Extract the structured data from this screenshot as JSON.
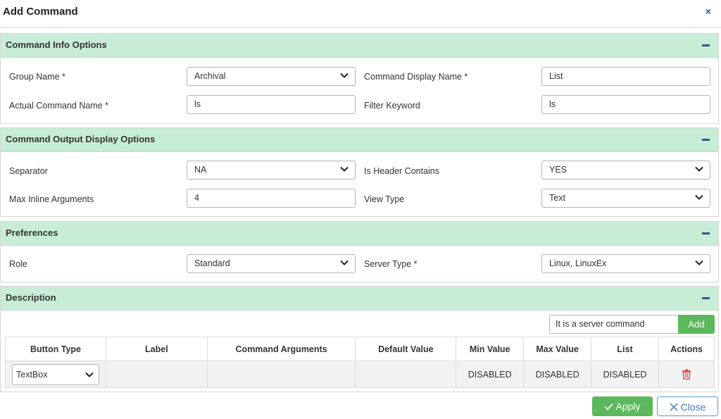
{
  "dialog": {
    "title": "Add Command",
    "close_glyph": "×"
  },
  "sections": {
    "info": {
      "title": "Command Info Options",
      "group_name_label": "Group Name *",
      "group_name_value": "Archival",
      "display_name_label": "Command Display Name *",
      "display_name_value": "List",
      "actual_name_label": "Actual Command Name *",
      "actual_name_value": "ls",
      "filter_keyword_label": "Filter Keyword",
      "filter_keyword_value": "ls"
    },
    "output": {
      "title": "Command Output Display Options",
      "separator_label": "Separator",
      "separator_value": "NA",
      "header_label": "Is Header Contains",
      "header_value": "YES",
      "max_inline_label": "Max Inline Arguments",
      "max_inline_value": "4",
      "view_type_label": "View Type",
      "view_type_value": "Text"
    },
    "preferences": {
      "title": "Preferences",
      "role_label": "Role",
      "role_value": "Standard",
      "server_type_label": "Server Type *",
      "server_type_value": "Linux, LinuxEx"
    },
    "description": {
      "title": "Description",
      "input_value": "It is a server command",
      "add_label": "Add"
    }
  },
  "table": {
    "headers": [
      "Button Type",
      "Label",
      "Command Arguments",
      "Default Value",
      "Min Value",
      "Max Value",
      "List",
      "Actions"
    ],
    "rows": [
      {
        "button_type": "TextBox",
        "label": "",
        "args": "",
        "default": "",
        "min": "DISABLED",
        "max": "DISABLED",
        "list": "DISABLED"
      }
    ]
  },
  "footer": {
    "apply_label": "Apply",
    "close_label": "Close"
  },
  "colors": {
    "section_header": "#c8edd6",
    "accent": "#2c5a8a",
    "success": "#5cb85c",
    "danger": "#d9534f",
    "close_border": "#5b9bd5"
  },
  "icons": {
    "collapse": "minus-icon",
    "dropdown": "chevron-down-icon",
    "delete": "trash-icon",
    "apply": "check-icon",
    "close": "x-icon"
  }
}
